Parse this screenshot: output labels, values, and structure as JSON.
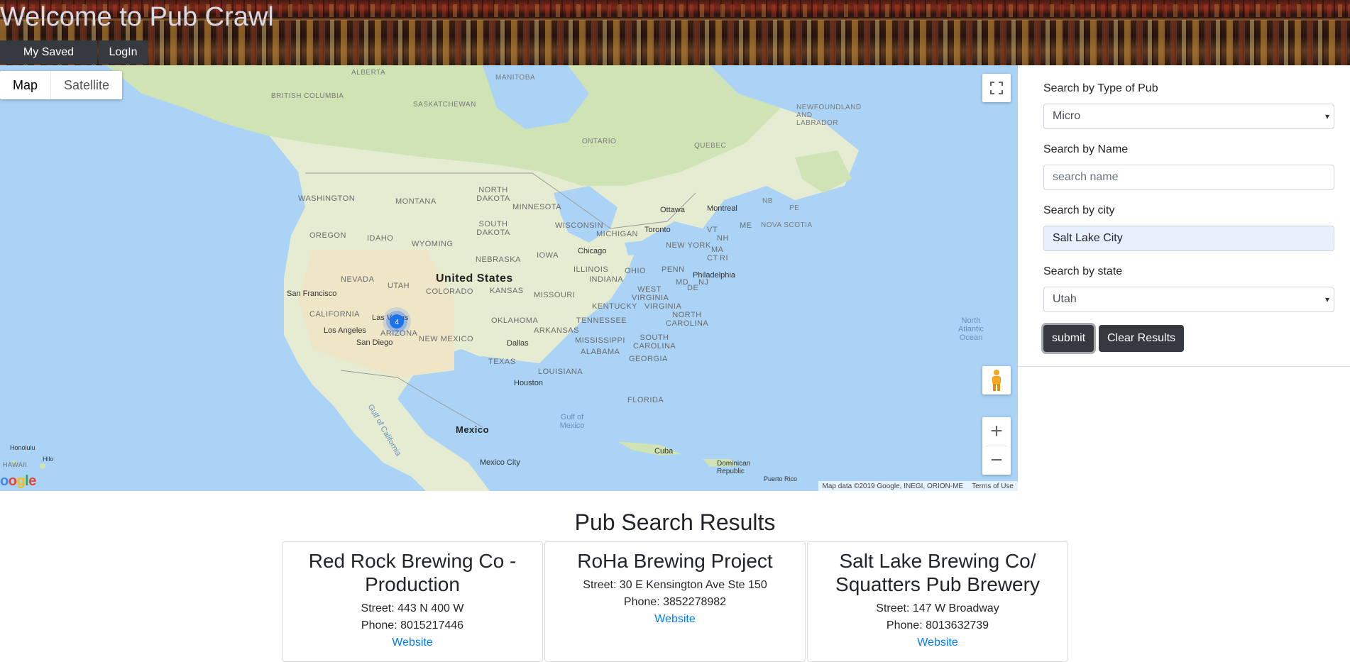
{
  "header": {
    "title": "Welcome to Pub Crawl",
    "nav": [
      {
        "label": "My Saved Pub's"
      },
      {
        "label": "LogIn"
      }
    ]
  },
  "map": {
    "type_buttons": [
      "Map",
      "Satellite"
    ],
    "active_type": "Map",
    "cluster_count": "4",
    "attribution": "Map data ©2019 Google, INEGI, ORION-ME",
    "terms": "Terms of Use",
    "logo": "Google",
    "icons": [
      "fullscreen-icon",
      "pegman-icon",
      "zoom-in-icon",
      "zoom-out-icon"
    ],
    "labels": {
      "countries": [
        "United States",
        "Mexico"
      ],
      "states": [
        "WASHINGTON",
        "OREGON",
        "CALIFORNIA",
        "NEVADA",
        "IDAHO",
        "MONTANA",
        "WYOMING",
        "UTAH",
        "COLORADO",
        "ARIZONA",
        "NEW MEXICO",
        "NORTH DAKOTA",
        "SOUTH DAKOTA",
        "NEBRASKA",
        "KANSAS",
        "OKLAHOMA",
        "TEXAS",
        "MINNESOTA",
        "IOWA",
        "MISSOURI",
        "ARKANSAS",
        "LOUISIANA",
        "WISCONSIN",
        "ILLINOIS",
        "MICHIGAN",
        "INDIANA",
        "OHIO",
        "KENTUCKY",
        "TENNESSEE",
        "MISSISSIPPI",
        "ALABAMA",
        "GEORGIA",
        "FLORIDA",
        "SOUTH CAROLINA",
        "NORTH CAROLINA",
        "VIRGINIA",
        "WEST VIRGINIA",
        "PENN",
        "NEW YORK",
        "VT",
        "NH",
        "ME",
        "MA",
        "CT",
        "RI",
        "NJ",
        "MD",
        "DE",
        "HAWAII"
      ],
      "provinces": [
        "BRITISH COLUMBIA",
        "ALBERTA",
        "SASKATCHEWAN",
        "MANITOBA",
        "ONTARIO",
        "QUEBEC",
        "NEWFOUNDLAND AND LABRADOR",
        "NB",
        "PE",
        "NOVA SCOTIA"
      ],
      "cities": [
        "San Francisco",
        "Las Vegas",
        "Los Angeles",
        "San Diego",
        "Chicago",
        "Dallas",
        "Houston",
        "Toronto",
        "Ottawa",
        "Montreal",
        "Philadelphia",
        "Mexico City",
        "Honolulu",
        "Hilo",
        "Cuba",
        "Dominican Republic",
        "Puerto Rico"
      ],
      "waters": [
        "North Atlantic Ocean",
        "Gulf of Mexico",
        "Gulf of California"
      ]
    }
  },
  "search": {
    "type_label": "Search by Type of Pub",
    "type_value": "Micro",
    "name_label": "Search by Name",
    "name_placeholder": "search name",
    "city_label": "Search by city",
    "city_value": "Salt Lake City",
    "state_label": "Search by state",
    "state_value": "Utah",
    "submit_label": "submit",
    "clear_label": "Clear Results"
  },
  "results": {
    "title": "Pub Search Results",
    "cards": [
      {
        "name": "Red Rock Brewing Co - Production",
        "street": "Street: 443 N 400 W",
        "phone": "Phone: 8015217446",
        "link": "Website"
      },
      {
        "name": "RoHa Brewing Project",
        "street": "Street: 30 E Kensington Ave Ste 150",
        "phone": "Phone: 3852278982",
        "link": "Website"
      },
      {
        "name": "Salt Lake Brewing Co/ Squatters Pub Brewery",
        "street": "Street: 147 W Broadway",
        "phone": "Phone: 8013632739",
        "link": "Website"
      }
    ]
  }
}
